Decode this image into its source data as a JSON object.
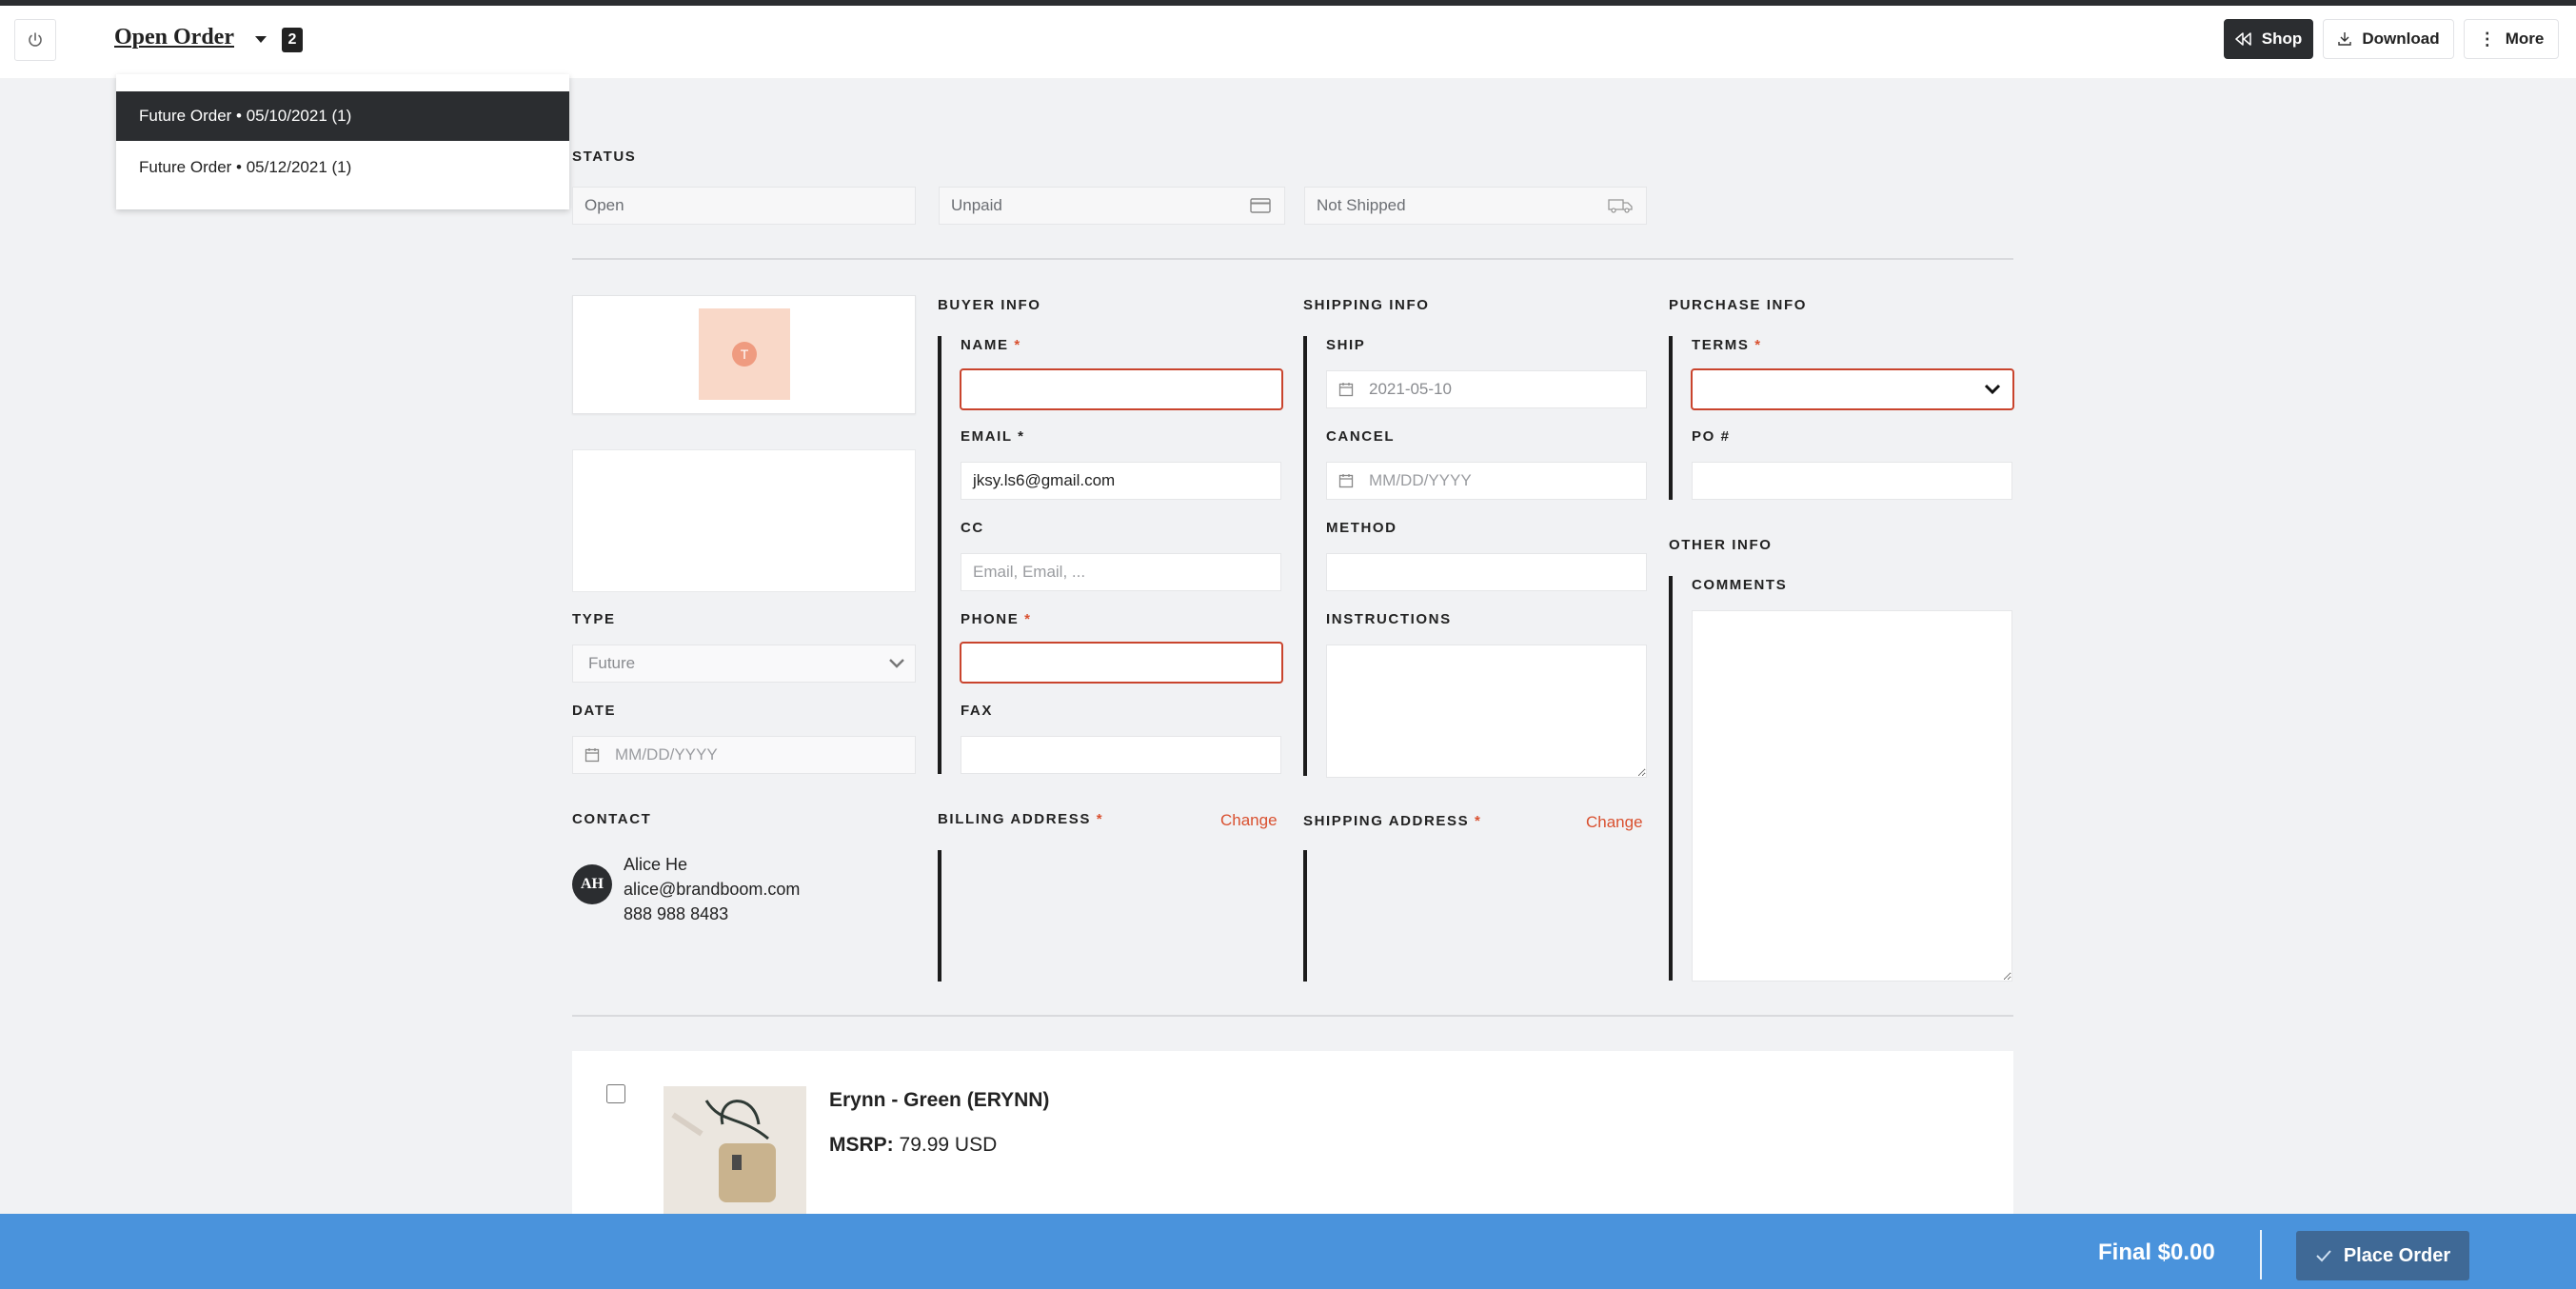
{
  "header": {
    "order_title": "Open Order",
    "order_count": "2",
    "shop_label": "Shop",
    "download_label": "Download",
    "more_label": "More"
  },
  "order_dropdown": {
    "items": [
      {
        "label": "Future Order • 05/10/2021 (1)",
        "active": true
      },
      {
        "label": "Future Order • 05/12/2021 (1)",
        "active": false
      }
    ]
  },
  "status": {
    "label": "STATUS",
    "order_status": "Open",
    "payment_status": "Unpaid",
    "shipping_status": "Not Shipped"
  },
  "logo_card": {
    "letter": "T"
  },
  "type": {
    "label": "TYPE",
    "value": "Future"
  },
  "date": {
    "label": "DATE",
    "placeholder": "MM/DD/YYYY"
  },
  "contact": {
    "label": "CONTACT",
    "initials": "AH",
    "name": "Alice He",
    "email": "alice@brandboom.com",
    "phone": "888 988 8483"
  },
  "buyer_info": {
    "label": "BUYER INFO",
    "name_label": "NAME",
    "name_value": "",
    "email_label": "EMAIL *",
    "email_value": "jksy.ls6@gmail.com",
    "cc_label": "CC",
    "cc_placeholder": "Email, Email, ...",
    "phone_label": "PHONE",
    "phone_value": "",
    "fax_label": "FAX",
    "fax_value": ""
  },
  "shipping_info": {
    "label": "SHIPPING INFO",
    "ship_label": "SHIP",
    "ship_value": "2021-05-10",
    "cancel_label": "CANCEL",
    "cancel_placeholder": "MM/DD/YYYY",
    "method_label": "METHOD",
    "method_value": "",
    "instructions_label": "INSTRUCTIONS"
  },
  "purchase_info": {
    "label": "PURCHASE INFO",
    "terms_label": "TERMS",
    "terms_value": "",
    "po_label": "PO #",
    "po_value": ""
  },
  "other_info": {
    "label": "OTHER INFO",
    "comments_label": "COMMENTS"
  },
  "billing_address": {
    "label": "BILLING ADDRESS",
    "change_label": "Change"
  },
  "shipping_address": {
    "label": "SHIPPING ADDRESS",
    "change_label": "Change"
  },
  "product": {
    "name": "Erynn - Green (ERYNN)",
    "msrp_label": "MSRP:",
    "msrp_value": "79.99 USD"
  },
  "footer": {
    "final_text": "Final $0.00",
    "place_order_label": "Place Order"
  },
  "colors": {
    "accent_red": "#d9502f",
    "footer_blue": "#4a93dc",
    "place_button": "#3f6996",
    "dark": "#2b2d30"
  }
}
